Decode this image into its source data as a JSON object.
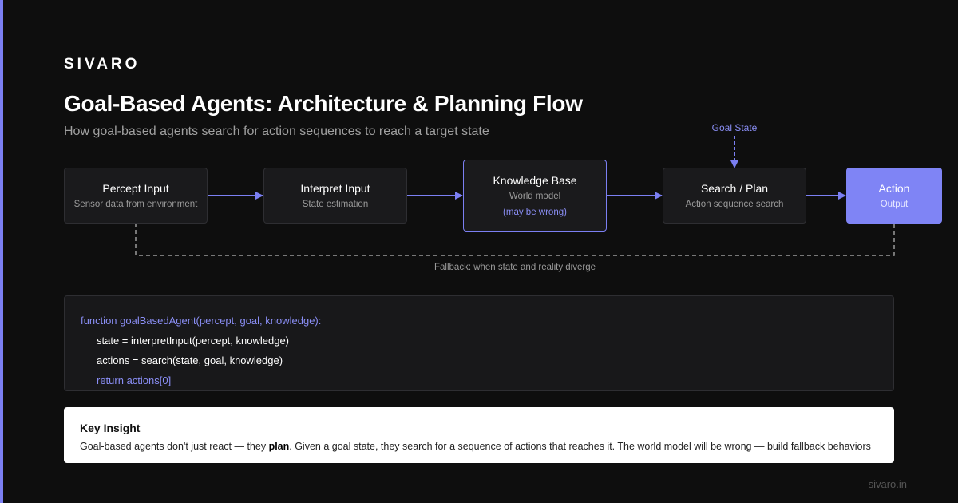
{
  "brand": "SIVARO",
  "title": "Goal-Based Agents: Architecture & Planning Flow",
  "subtitle": "How goal-based agents search for action sequences to reach a target state",
  "colors": {
    "accent": "#7b7ff2",
    "background": "#0e0e0e",
    "node_bg": "#1a1a1c",
    "action_bg": "#7f84f5"
  },
  "diagram": {
    "nodes": [
      {
        "id": "percept",
        "title": "Percept Input",
        "sub": "Sensor data from environment"
      },
      {
        "id": "interpret",
        "title": "Interpret Input",
        "sub": "State estimation"
      },
      {
        "id": "knowledge",
        "title": "Knowledge Base",
        "sub": "World model",
        "note": "(may be wrong)"
      },
      {
        "id": "search",
        "title": "Search / Plan",
        "sub": "Action sequence search"
      },
      {
        "id": "action",
        "title": "Action",
        "sub": "Output"
      }
    ],
    "goal_label": "Goal State",
    "fallback_label": "Fallback: when state and reality diverge"
  },
  "code": {
    "lines": [
      "function goalBasedAgent(percept, goal, knowledge):",
      "state = interpretInput(percept, knowledge)",
      "actions = search(state, goal, knowledge)",
      "return actions[0]"
    ]
  },
  "insight": {
    "title": "Key Insight",
    "body_pre": "Goal-based agents don't just react — they ",
    "body_bold": "plan",
    "body_post": ". Given a goal state, they search for a sequence of actions that reaches it. The world model will be wrong — build fallback behaviors"
  },
  "footer": "sivaro.in"
}
